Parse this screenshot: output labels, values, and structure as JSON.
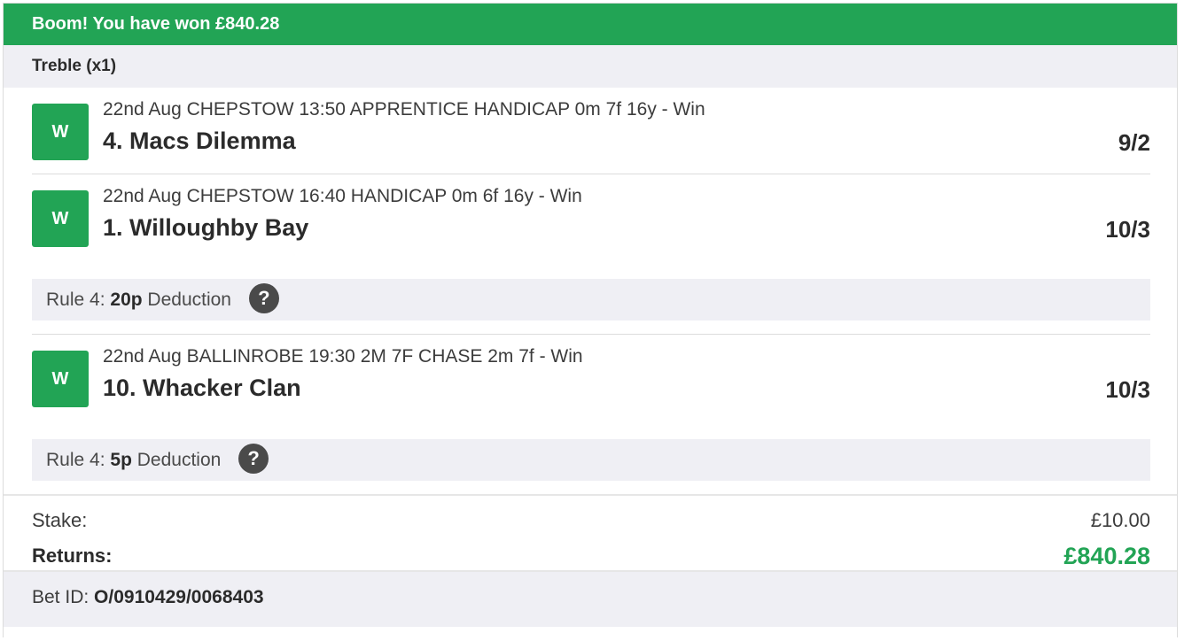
{
  "banner": {
    "text": "Boom! You have won £840.28"
  },
  "bet": {
    "type": "Treble (x1)"
  },
  "selections": [
    {
      "result": "W",
      "event": "22nd Aug CHEPSTOW 13:50 APPRENTICE HANDICAP 0m 7f 16y - Win",
      "horse": "4. Macs Dilemma",
      "odds": "9/2"
    },
    {
      "result": "W",
      "event": "22nd Aug CHEPSTOW 16:40 HANDICAP 0m 6f 16y - Win",
      "horse": "1. Willoughby Bay",
      "odds": "10/3",
      "rule4": {
        "prefix": "Rule 4:",
        "amount": "20p",
        "suffix": "Deduction"
      }
    },
    {
      "result": "W",
      "event": "22nd Aug BALLINROBE 19:30 2M 7F CHASE 2m 7f - Win",
      "horse": "10. Whacker Clan",
      "odds": "10/3",
      "rule4": {
        "prefix": "Rule 4:",
        "amount": "5p",
        "suffix": "Deduction"
      }
    }
  ],
  "totals": {
    "stake_label": "Stake:",
    "stake_value": "£10.00",
    "returns_label": "Returns:",
    "returns_value": "£840.28"
  },
  "footer": {
    "label": "Bet ID:",
    "value": "O/0910429/0068403"
  },
  "icons": {
    "help": "question-mark-icon"
  },
  "colors": {
    "accent": "#22a455",
    "panel": "#efeff4",
    "help_icon": "#4a4a4a"
  }
}
